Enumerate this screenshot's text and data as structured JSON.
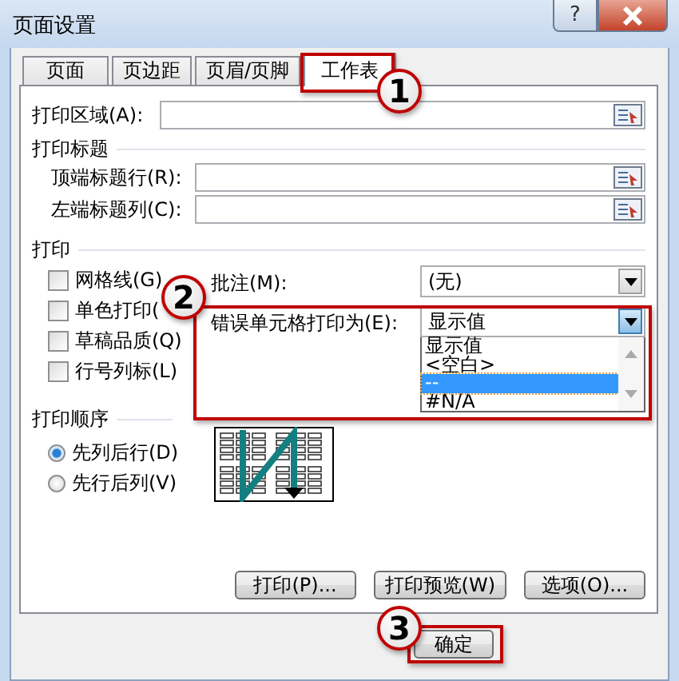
{
  "window": {
    "title": "页面设置",
    "help_button": "?"
  },
  "tabs": [
    {
      "label": "页面",
      "selected": false
    },
    {
      "label": "页边距",
      "selected": false
    },
    {
      "label": "页眉/页脚",
      "selected": false
    },
    {
      "label": "工作表",
      "selected": true
    }
  ],
  "print_area": {
    "label": "打印区域(A):"
  },
  "print_titles": {
    "heading": "打印标题",
    "fields": [
      {
        "label": "顶端标题行(R):"
      },
      {
        "label": "左端标题列(C):"
      }
    ]
  },
  "print": {
    "heading": "打印",
    "checkboxes": [
      {
        "label": "网格线(G)",
        "checked": false
      },
      {
        "label": "单色打印(",
        "checked": false
      },
      {
        "label": "草稿品质(Q)",
        "checked": false
      },
      {
        "label": "行号列标(L)",
        "checked": false
      }
    ],
    "comments": {
      "label": "批注(M):",
      "value": "(无)"
    },
    "errors": {
      "label": "错误单元格打印为(E):",
      "value": "显示值",
      "expanded": true,
      "options": [
        {
          "label": "显示值",
          "highlighted": false
        },
        {
          "label": "<空白>",
          "highlighted": false
        },
        {
          "label": "--",
          "highlighted": true
        },
        {
          "label": "#N/A",
          "highlighted": false
        }
      ]
    }
  },
  "print_order": {
    "heading": "打印顺序",
    "options": [
      {
        "label": "先列后行(D)",
        "selected": true
      },
      {
        "label": "先行后列(V)",
        "selected": false
      }
    ]
  },
  "buttons": [
    "打印(P)...",
    "打印预览(W)",
    "选项(O)..."
  ],
  "ok_button": "确定",
  "annotations": [
    {
      "number": "1"
    },
    {
      "number": "2"
    },
    {
      "number": "3"
    }
  ]
}
